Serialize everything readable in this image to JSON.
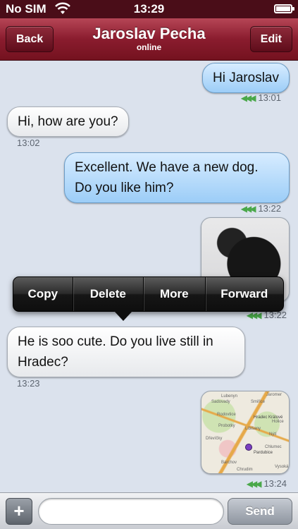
{
  "status_bar": {
    "carrier": "No SIM",
    "time": "13:29"
  },
  "nav": {
    "back_label": "Back",
    "title": "Jaroslav Pecha",
    "subtitle": "online",
    "edit_label": "Edit"
  },
  "messages": [
    {
      "direction": "outgoing",
      "text": "Hi Jaroslav",
      "time": "13:01"
    },
    {
      "direction": "incoming",
      "text": "Hi, how are you?",
      "time": "13:02"
    },
    {
      "direction": "outgoing",
      "text": "Excellent. We have a new dog. Do you like him?",
      "time": "13:22"
    },
    {
      "direction": "outgoing",
      "type": "photo",
      "time": "13:22"
    },
    {
      "direction": "incoming",
      "text": "He is soo cute. Do you live still in Hradec?",
      "time": "13:23"
    },
    {
      "direction": "outgoing",
      "type": "map",
      "time": "13:24"
    }
  ],
  "map_labels": [
    "Lubenyn",
    "Jaromer",
    "Sadovady",
    "Smiřice",
    "Rodovtice",
    "Hradec Králové",
    "Probotky",
    "Libišany",
    "Nýtí",
    "Pardubice",
    "Chrudim",
    "Vysoká",
    "Barchov",
    "Dřevíčky",
    "Chlumec",
    "Holice"
  ],
  "context_menu": {
    "items": [
      "Copy",
      "Delete",
      "More",
      "Forward"
    ]
  },
  "input_bar": {
    "plus_label": "+",
    "placeholder": "",
    "send_label": "Send"
  },
  "icons": {
    "wifi": "wifi-icon",
    "battery": "battery-charging-icon",
    "delivered": "delivered-ticks-icon"
  },
  "colors": {
    "navbar": "#8a1c2e",
    "outgoing_bubble": "#9ccdf7",
    "incoming_bubble": "#ffffff",
    "chat_background": "#dbe2ed",
    "delivered_ticks": "#4aa84a"
  }
}
